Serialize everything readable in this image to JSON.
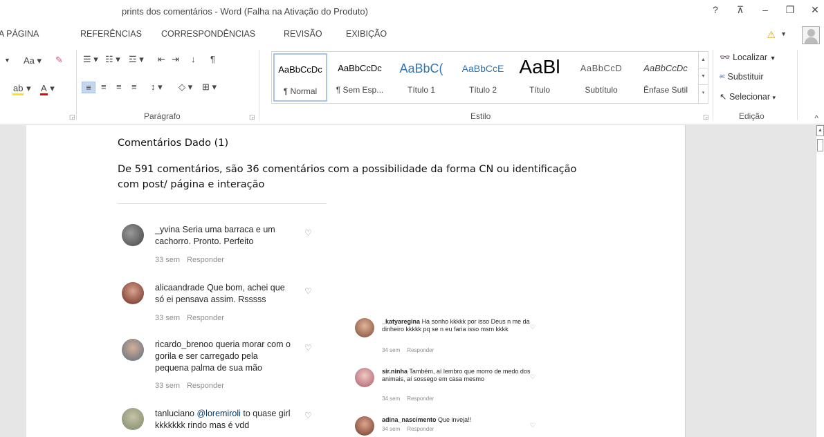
{
  "window": {
    "title": "prints dos comentários - Word (Falha na Ativação do Produto)",
    "help_icon": "?",
    "ribbon_display_icon": "⊼",
    "minimize_icon": "–",
    "restore_icon": "❐",
    "close_icon": "✕"
  },
  "tabs": [
    "A PÁGINA",
    "REFERÊNCIAS",
    "CORRESPONDÊNCIAS",
    "REVISÃO",
    "EXIBIÇÃO"
  ],
  "ribbon": {
    "font_group": {
      "change_case": "Aa",
      "font_color": "A"
    },
    "paragraph_label": "Parágrafo",
    "styles_label": "Estilo",
    "editing_label": "Edição",
    "styles": [
      {
        "sample": "AaBbCcDc",
        "name": "¶ Normal"
      },
      {
        "sample": "AaBbCcDc",
        "name": "¶ Sem Esp..."
      },
      {
        "sample": "AaBbC(",
        "name": "Título 1"
      },
      {
        "sample": "AaBbCcE",
        "name": "Título 2"
      },
      {
        "sample": "AaBl",
        "name": "Título"
      },
      {
        "sample": "AaBbCcD",
        "name": "Subtítulo"
      },
      {
        "sample": "AaBbCcDc",
        "name": "Ênfase Sutil"
      }
    ],
    "editing": {
      "find": "Localizar",
      "replace": "Substituir",
      "select": "Selecionar"
    }
  },
  "document": {
    "heading": "Comentários Dado (1)",
    "paragraph_line1": "De 591 comentários, são 36 comentários com a possibilidade da forma CN ou identificação",
    "paragraph_line2": "com post/ página e interação",
    "screenshot1": {
      "comments": [
        {
          "user": "_yvina",
          "text": "Seria uma barraca e um cachorro. Pronto. Perfeito",
          "time": "33 sem",
          "reply": "Responder"
        },
        {
          "user": "alicaandrade",
          "text": "Que bom, achei que só ei pensava assim. Rsssss",
          "time": "33 sem",
          "reply": "Responder"
        },
        {
          "user": "ricardo_brenoo",
          "text": "queria morar com o gorila e ser carregado pela pequena palma de sua mão",
          "time": "33 sem",
          "reply": "Responder"
        },
        {
          "user": "tanluciano",
          "mention": "@loremiroli",
          "text": "to quase girl kkkkkkk rindo mas é vdd"
        }
      ]
    },
    "screenshot2": {
      "comments": [
        {
          "user": "_katyaregina",
          "text": "Ha sonho kkkkk por isso Deus n me da dinheiro kkkkk pq se n eu faria isso msm kkkk",
          "time": "34 sem",
          "reply": "Responder"
        },
        {
          "user": "sir.ninha",
          "text": "Também, aí lembro que morro de medo dos animais, aí sossego em casa mesmo",
          "time": "34 sem",
          "reply": "Responder"
        },
        {
          "user": "adina_nascimento",
          "text": "Que inveja!!",
          "time": "34 sem",
          "reply": "Responder"
        }
      ]
    }
  }
}
